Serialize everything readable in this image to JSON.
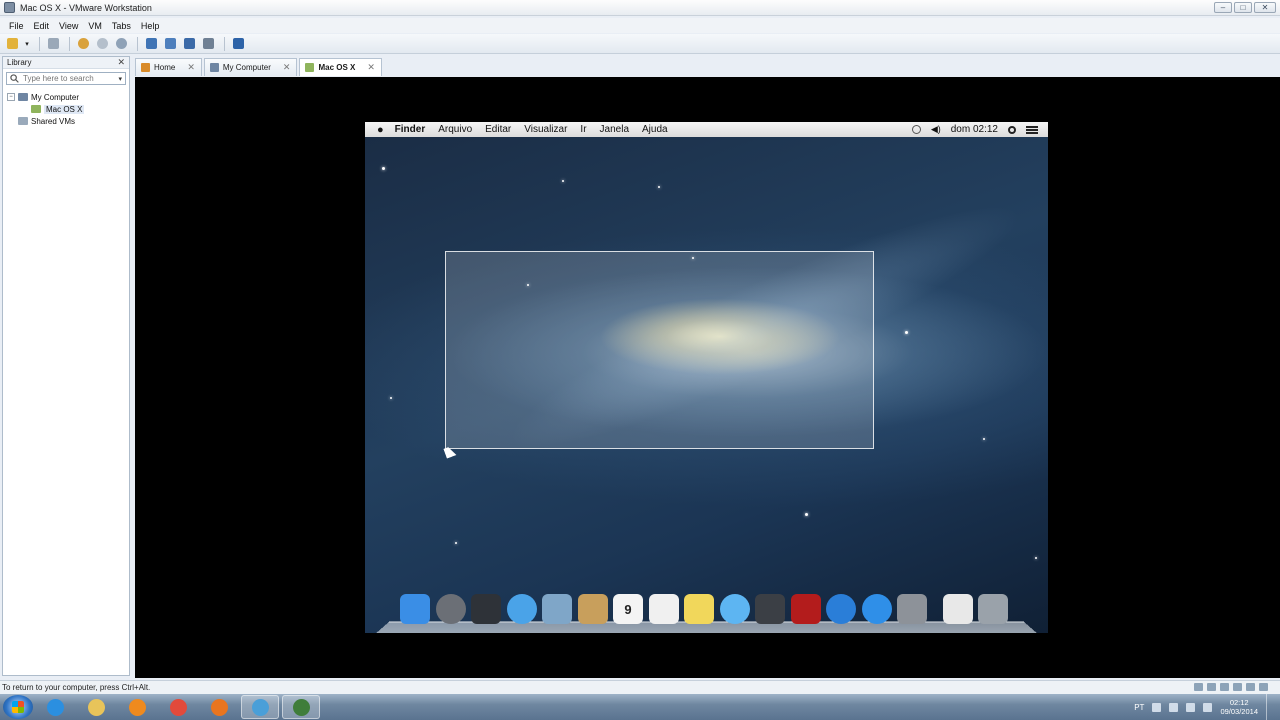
{
  "window": {
    "title": "Mac OS X - VMware Workstation"
  },
  "menubar": {
    "items": [
      "File",
      "Edit",
      "View",
      "VM",
      "Tabs",
      "Help"
    ]
  },
  "library": {
    "title": "Library",
    "search_placeholder": "Type here to search",
    "tree": {
      "my_computer": "My Computer",
      "vm": "Mac OS X",
      "shared": "Shared VMs"
    }
  },
  "tabs": [
    {
      "label": "Home"
    },
    {
      "label": "My Computer"
    },
    {
      "label": "Mac OS X"
    }
  ],
  "mac": {
    "menu": [
      "Finder",
      "Arquivo",
      "Editar",
      "Visualizar",
      "Ir",
      "Janela",
      "Ajuda"
    ],
    "clock": "dom 02:12",
    "dock": [
      {
        "name": "finder-icon",
        "color": "#3a8ee6"
      },
      {
        "name": "launchpad-icon",
        "color": "#6b6f76"
      },
      {
        "name": "mission-control-icon",
        "color": "#2e3238"
      },
      {
        "name": "safari-icon",
        "color": "#4aa3e8"
      },
      {
        "name": "mail-icon",
        "color": "#7fa6c8"
      },
      {
        "name": "contacts-icon",
        "color": "#c89f5c"
      },
      {
        "name": "calendar-icon",
        "color": "#f4f4f4",
        "text": "9"
      },
      {
        "name": "reminders-icon",
        "color": "#f0f0f0"
      },
      {
        "name": "notes-icon",
        "color": "#f1d75b"
      },
      {
        "name": "messages-icon",
        "color": "#5db5f2"
      },
      {
        "name": "facetime-icon",
        "color": "#3b3f45"
      },
      {
        "name": "photo-booth-icon",
        "color": "#b31c1c"
      },
      {
        "name": "itunes-icon",
        "color": "#2a7ed8"
      },
      {
        "name": "app-store-icon",
        "color": "#2f8fe8"
      },
      {
        "name": "system-preferences-icon",
        "color": "#8d9299"
      },
      {
        "name": "document-icon",
        "color": "#e8e8e8"
      },
      {
        "name": "trash-icon",
        "color": "#9aa2aa"
      }
    ]
  },
  "statusbar": {
    "text": "To return to your computer, press Ctrl+Alt."
  },
  "taskbar": {
    "apps": [
      {
        "name": "internet-explorer-icon",
        "color": "#2b8fe0"
      },
      {
        "name": "file-explorer-icon",
        "color": "#e8c45a"
      },
      {
        "name": "media-player-icon",
        "color": "#ef8a1e"
      },
      {
        "name": "chrome-icon",
        "color": "#e24a3b"
      },
      {
        "name": "firefox-icon",
        "color": "#e8751f"
      },
      {
        "name": "vmware-icon",
        "color": "#4a9fd8"
      },
      {
        "name": "recorder-icon",
        "color": "#3f7d3a"
      }
    ],
    "lang": "PT",
    "time": "02:12",
    "date": "09/03/2014"
  }
}
